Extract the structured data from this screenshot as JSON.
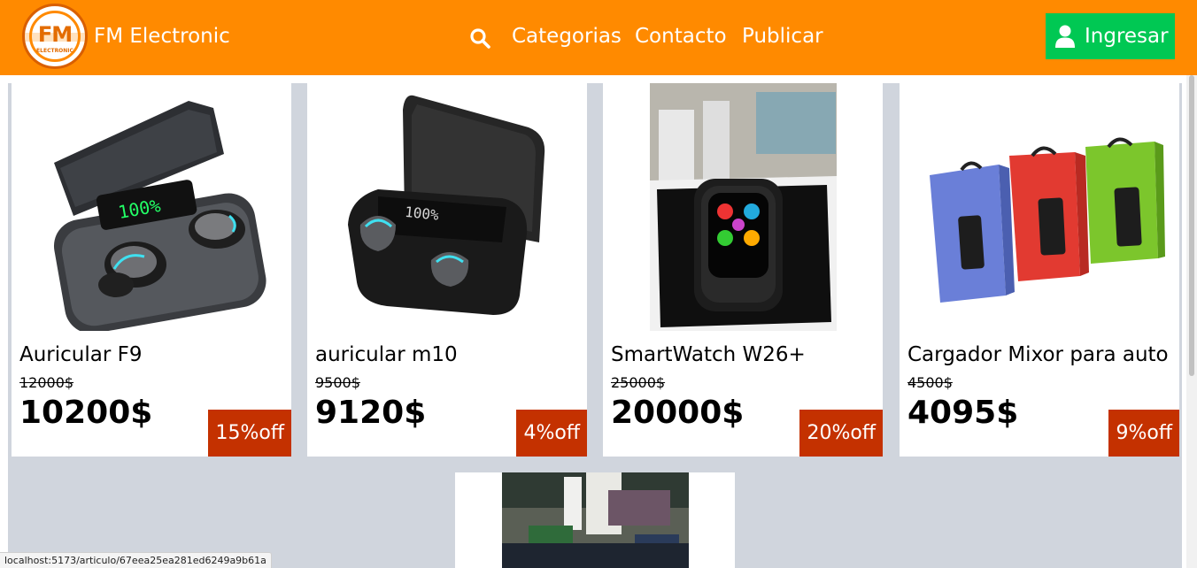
{
  "header": {
    "logo_text": "FM",
    "logo_subtext": "ELECTRONIC",
    "brand": "FM Electronic",
    "nav": [
      "Categorias",
      "Contacto",
      "Publicar"
    ],
    "login_label": "Ingresar"
  },
  "products": [
    {
      "name": "Auricular F9",
      "old_price": "12000$",
      "price": "10200$",
      "discount": "15%off"
    },
    {
      "name": "auricular m10",
      "old_price": "9500$",
      "price": "9120$",
      "discount": "4%off"
    },
    {
      "name": "SmartWatch W26+",
      "old_price": "25000$",
      "price": "20000$",
      "discount": "20%off"
    },
    {
      "name": "Cargador Mixor para auto",
      "old_price": "4500$",
      "price": "4095$",
      "discount": "9%off"
    }
  ],
  "status_url": "localhost:5173/articulo/67eea25ea281ed6249a9b61a",
  "colors": {
    "header": "#ff8a00",
    "login": "#00c853",
    "badge": "#c43100",
    "background": "#d0d5dd"
  }
}
